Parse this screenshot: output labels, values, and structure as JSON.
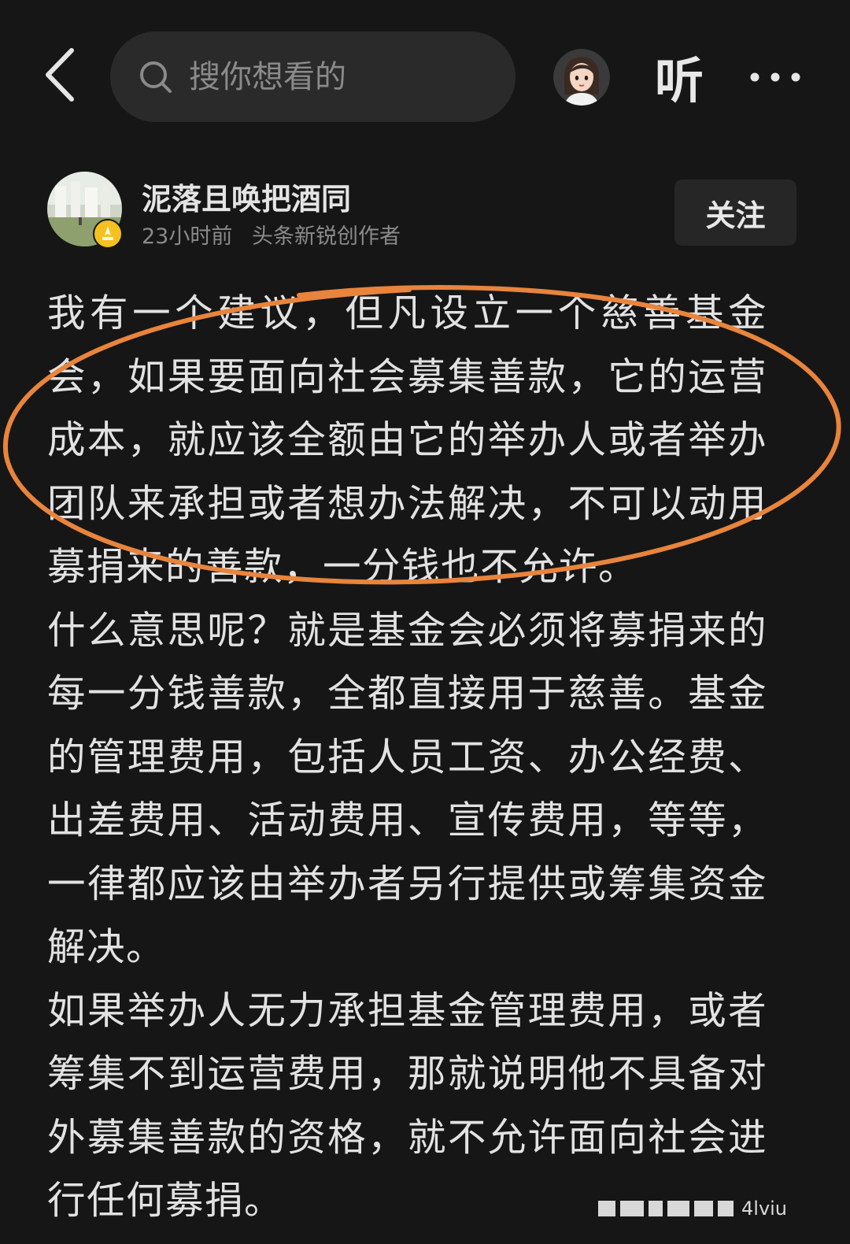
{
  "topbar": {
    "search_placeholder": "搜你想看的",
    "listen_label": "听"
  },
  "author": {
    "name": "泥落且唤把酒同",
    "time": "23小时前",
    "title": "头条新锐创作者",
    "follow_label": "关注"
  },
  "article": {
    "paragraphs": [
      "我有一个建议，但凡设立一个慈善基金会，如果要面向社会募集善款，它的运营成本，就应该全额由它的举办人或者举办团队来承担或者想办法解决，不可以动用募捐来的善款，一分钱也不允许。",
      "什么意思呢？就是基金会必须将募捐来的每一分钱善款，全都直接用于慈善。基金的管理费用，包括人员工资、办公经费、出差费用、活动费用、宣传费用，等等，一律都应该由举办者另行提供或筹集资金解决。",
      "如果举办人无力承担基金管理费用，或者筹集不到运营费用，那就说明他不具备对外募集善款的资格，就不允许面向社会进行任何募捐。"
    ]
  },
  "annotation": {
    "ellipse_color": "#e8843c"
  },
  "watermark": {
    "text": "4lviu"
  },
  "colors": {
    "background": "#161616",
    "search_bg": "#2a2a2a",
    "text_primary": "#e2e2e2",
    "text_secondary": "#8a8a8a",
    "badge_gold": "#f5c120"
  }
}
